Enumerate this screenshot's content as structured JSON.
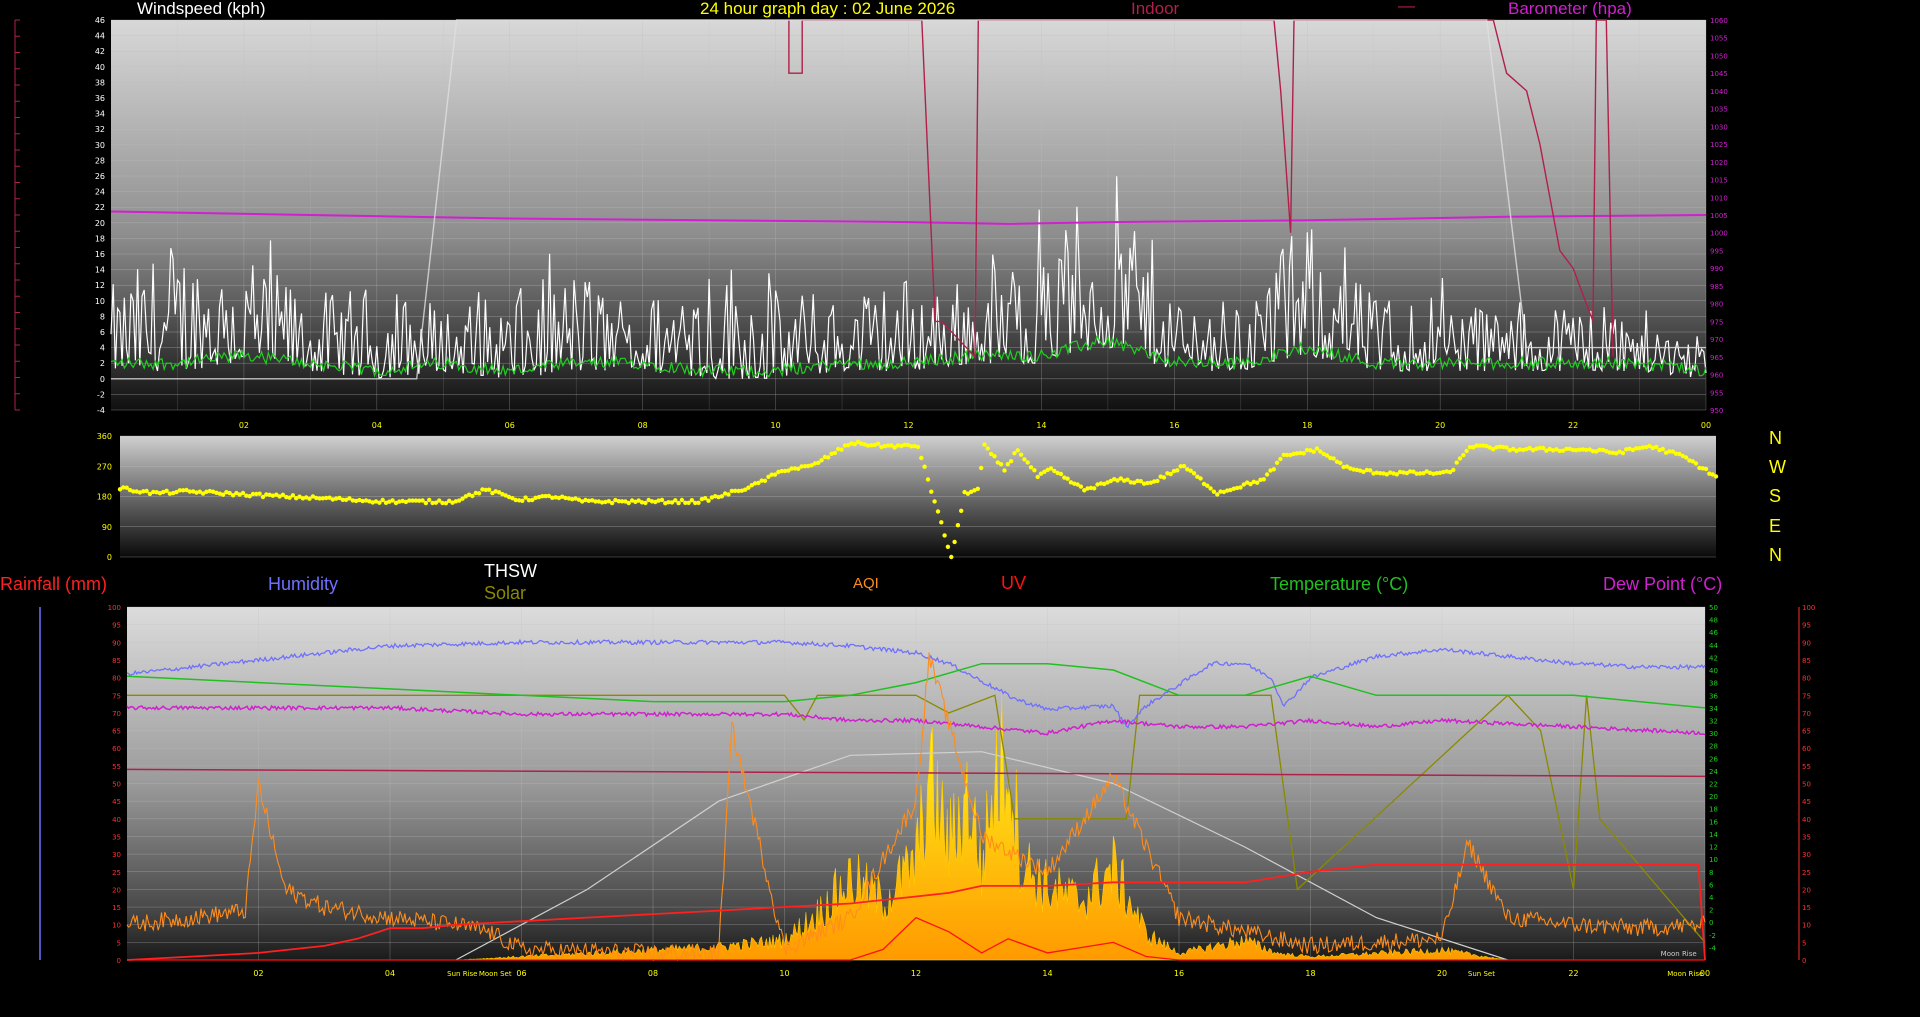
{
  "header": {
    "windspeed": "Windspeed (kph)",
    "title": "24 hour graph day : 02 June 2026",
    "indoor": "Indoor",
    "indoor_dash": "—",
    "barometer": "Barometer (hpa)"
  },
  "compass": [
    "N",
    "W",
    "S",
    "E",
    "N"
  ],
  "legend": {
    "rainfall": "Rainfall (mm)",
    "humidity": "Humidity",
    "thsw": "THSW",
    "solar": "Solar",
    "aqi": "AQI",
    "uv": "UV",
    "temperature": "Temperature (°C)",
    "dewpoint": "Dew Point (°C)"
  },
  "colors": {
    "windspeed": "#ffffff",
    "title": "#ffff00",
    "indoor": "#b0204a",
    "barometer": "#d020d0",
    "wind_dir": "#ffff00",
    "rainfall": "#ff2020",
    "humidity": "#7070ff",
    "solar": "#8a8a00",
    "aqi": "#ff8c1a",
    "uv": "#ff1010",
    "temperature": "#20c020",
    "dewpoint": "#d020d0"
  },
  "chart_data": [
    {
      "type": "line",
      "name": "wind-baro-panel",
      "title": "24 hour graph day : 02 June 2026",
      "x_ticks": [
        "02",
        "04",
        "06",
        "08",
        "10",
        "12",
        "14",
        "16",
        "18",
        "20",
        "22",
        "00"
      ],
      "xlim": [
        0,
        24
      ],
      "left_axis": {
        "label": "Windspeed (kph)",
        "ylim": [
          -4,
          46
        ],
        "ticks": [
          -4,
          -2,
          0,
          2,
          4,
          6,
          8,
          10,
          12,
          14,
          16,
          18,
          20,
          22,
          24,
          26,
          28,
          30,
          32,
          34,
          36,
          38,
          40,
          42,
          44,
          46
        ]
      },
      "right_axis": {
        "label": "Barometer (hpa)",
        "ylim": [
          950,
          1060
        ],
        "ticks": [
          950,
          955,
          960,
          965,
          970,
          975,
          980,
          985,
          990,
          995,
          1000,
          1005,
          1010,
          1015,
          1020,
          1025,
          1030,
          1035,
          1040,
          1045,
          1050,
          1055,
          1060
        ]
      },
      "series": [
        {
          "name": "Barometer (hpa)",
          "x": [
            0,
            3,
            6,
            9,
            12,
            13.5,
            15,
            18,
            21,
            24
          ],
          "y": [
            1006,
            1005,
            1004,
            1003.5,
            1003,
            1002.5,
            1003,
            1003.5,
            1004.5,
            1005
          ]
        },
        {
          "name": "Indoor",
          "x": [
            10.2,
            10.2,
            10.4,
            10.4,
            12.2,
            12.4,
            12.5,
            13.0,
            13.05,
            15.2,
            15.25,
            17.5,
            17.6,
            17.75,
            17.8,
            20.8,
            21.0,
            21.3,
            21.5,
            21.8,
            22.0,
            22.3,
            22.35,
            22.5,
            22.6
          ],
          "y": [
            1060,
            1045,
            1045,
            1060,
            1060,
            975,
            975,
            965,
            1060,
            1060,
            1060,
            1060,
            1040,
            1000,
            1060,
            1060,
            1045,
            1040,
            1025,
            995,
            990,
            975,
            1060,
            1060,
            965
          ]
        },
        {
          "name": "THSW",
          "x": [
            0,
            4.6,
            5.2,
            5.3,
            20.7,
            21.3,
            24
          ],
          "y": [
            0,
            0,
            46,
            46,
            46,
            4,
            4
          ]
        }
      ],
      "wind_profile": {
        "x": [
          0,
          1,
          2,
          3,
          4,
          5,
          6,
          7,
          8,
          9,
          10,
          11,
          12,
          13,
          14,
          15,
          16,
          17,
          18,
          19,
          20,
          21,
          22,
          23,
          24
        ],
        "gust_peak": [
          11,
          18,
          14,
          10,
          12,
          9,
          11,
          14,
          9,
          18,
          12,
          10,
          13,
          11,
          16,
          24,
          12,
          9,
          18,
          10,
          11,
          9,
          10,
          8,
          7
        ],
        "average": [
          2,
          2,
          3,
          2,
          1,
          2,
          1,
          2,
          2,
          1,
          1,
          2,
          2,
          3,
          3,
          5,
          2,
          2,
          4,
          2,
          2,
          2,
          2,
          2,
          1
        ]
      }
    },
    {
      "type": "scatter",
      "name": "wind-direction-panel",
      "xlim": [
        0,
        24
      ],
      "ylim": [
        0,
        360
      ],
      "y_ticks": [
        0,
        90,
        180,
        270,
        360
      ],
      "series": [
        {
          "name": "direction",
          "x": [
            0,
            0.5,
            1,
            2,
            3,
            4,
            5,
            5.5,
            6,
            6.5,
            7,
            8,
            8.7,
            9,
            9.5,
            10,
            10.4,
            11,
            11.5,
            12,
            12.5,
            12.6,
            12.7,
            12.9,
            13,
            13.3,
            13.5,
            13.8,
            14,
            14.5,
            15,
            15.5,
            16,
            16.5,
            17,
            17.2,
            17.5,
            18,
            18.5,
            19,
            20,
            20.3,
            21,
            22,
            22.5,
            23,
            23.5,
            24
          ],
          "y": [
            205,
            190,
            195,
            185,
            175,
            165,
            165,
            200,
            170,
            180,
            165,
            165,
            165,
            180,
            210,
            260,
            270,
            340,
            330,
            330,
            0,
            90,
            190,
            200,
            330,
            260,
            320,
            240,
            260,
            200,
            230,
            220,
            270,
            190,
            220,
            230,
            300,
            320,
            260,
            250,
            250,
            330,
            320,
            320,
            310,
            330,
            300,
            240
          ]
        }
      ]
    },
    {
      "type": "area",
      "name": "env-panel",
      "x_ticks": [
        "02",
        "04",
        "06",
        "08",
        "10",
        "12",
        "14",
        "16",
        "18",
        "20",
        "22",
        "00"
      ],
      "annotations": [
        "Sun Rise",
        "Moon Set",
        "Sun Set",
        "Moon Rise"
      ],
      "annotation_x": [
        5.1,
        5.6,
        20.6,
        23.7
      ],
      "xlim": [
        0,
        24
      ],
      "left_axis": {
        "ylim": [
          0,
          100
        ],
        "ticks": [
          0,
          5,
          10,
          15,
          20,
          25,
          30,
          35,
          40,
          45,
          50,
          55,
          60,
          65,
          70,
          75,
          80,
          85,
          90,
          95,
          100
        ]
      },
      "right_green_axis": {
        "ylim": [
          -6,
          50
        ],
        "ticks": [
          -4,
          -2,
          0,
          2,
          4,
          6,
          8,
          10,
          12,
          14,
          16,
          18,
          20,
          22,
          24,
          26,
          28,
          30,
          32,
          34,
          36,
          38,
          40,
          42,
          44,
          46,
          48,
          50
        ]
      },
      "right_red_axis": {
        "ylim": [
          0,
          100
        ],
        "ticks": [
          0,
          5,
          10,
          15,
          20,
          25,
          30,
          35,
          40,
          45,
          50,
          55,
          60,
          65,
          70,
          75,
          80,
          85,
          90,
          95,
          100
        ]
      },
      "series": [
        {
          "name": "Humidity",
          "x": [
            0,
            1,
            2,
            3,
            4,
            6,
            8,
            10,
            11,
            12,
            12.5,
            13,
            13.5,
            14,
            15,
            15.2,
            15.5,
            16,
            16.5,
            17,
            17.4,
            17.6,
            18,
            19,
            20,
            21,
            22,
            23,
            24
          ],
          "y": [
            81,
            83,
            85,
            87,
            89,
            90,
            90,
            90,
            89,
            87,
            84,
            79,
            74,
            71,
            72,
            66,
            72,
            78,
            84,
            84,
            80,
            72,
            80,
            86,
            88,
            86,
            84,
            83,
            83
          ]
        },
        {
          "name": "Temperature (°C)",
          "x": [
            0,
            2,
            4,
            6,
            8,
            10,
            11,
            12,
            13,
            14,
            15,
            16,
            17,
            18,
            19,
            20,
            22,
            24
          ],
          "y": [
            39,
            38,
            37,
            36,
            35,
            35,
            36,
            38,
            41,
            41,
            40,
            36,
            36,
            39,
            36,
            36,
            36,
            34
          ]
        },
        {
          "name": "Dew Point (°C)",
          "x": [
            0,
            2,
            4,
            6,
            8,
            10,
            11,
            12,
            13,
            14,
            15,
            16,
            17,
            18,
            19,
            20,
            22,
            24
          ],
          "y": [
            34,
            34,
            34,
            33,
            33,
            33,
            32,
            32,
            31,
            30,
            32,
            31,
            31,
            32,
            31,
            32,
            31,
            30
          ]
        },
        {
          "name": "Barometer",
          "x": [
            0,
            12,
            24
          ],
          "y": [
            54,
            53,
            52
          ]
        },
        {
          "name": "Rainfall (mm)",
          "x": [
            0,
            1,
            2,
            3,
            3.5,
            4,
            4.5,
            5,
            6,
            7,
            8,
            9,
            10,
            11,
            12,
            12.5,
            13,
            14,
            15,
            16,
            17,
            18,
            19,
            20,
            21,
            22,
            23,
            23.9,
            24
          ],
          "y": [
            0,
            1,
            2,
            4,
            6,
            9,
            9,
            10,
            11,
            12,
            13,
            14,
            15,
            16,
            18,
            19,
            21,
            21,
            22,
            22,
            22,
            25,
            27,
            27,
            27,
            27,
            27,
            27,
            0
          ]
        },
        {
          "name": "Solar",
          "x": [
            0,
            5,
            6,
            8,
            9,
            10,
            10.5,
            11,
            11.5,
            12,
            12.2,
            12.5,
            12.8,
            13,
            13.2,
            13.4,
            13.6,
            14,
            14.5,
            15,
            15.5,
            16,
            17,
            17.5,
            18,
            19,
            20,
            21,
            22,
            24
          ],
          "y": [
            0,
            0,
            1,
            3,
            4,
            6,
            14,
            25,
            18,
            30,
            55,
            35,
            50,
            28,
            55,
            65,
            30,
            22,
            18,
            28,
            8,
            2,
            6,
            2,
            1,
            2,
            3,
            0,
            0,
            0
          ]
        },
        {
          "name": "AQI",
          "x": [
            0,
            1,
            1.8,
            2,
            2.4,
            3,
            4,
            5,
            5.5,
            6,
            8,
            9,
            9.2,
            10,
            11,
            12,
            12.2,
            13,
            14,
            15,
            16,
            17,
            17.5,
            18,
            19,
            20,
            20.4,
            21,
            22,
            23,
            24
          ],
          "y": [
            10,
            12,
            14,
            50,
            20,
            15,
            12,
            10,
            8,
            3,
            2,
            2,
            66,
            3,
            12,
            45,
            86,
            35,
            25,
            52,
            12,
            8,
            6,
            4,
            5,
            6,
            33,
            12,
            10,
            9,
            10
          ]
        },
        {
          "name": "UV",
          "x": [
            0,
            11,
            11.5,
            12,
            12.5,
            13,
            13.4,
            14,
            15,
            15.5,
            16,
            24
          ],
          "y": [
            0,
            0,
            3,
            12,
            8,
            2,
            6,
            2,
            5,
            1,
            0,
            0
          ]
        },
        {
          "name": "THSW",
          "x": [
            0,
            10,
            10.3,
            10.5,
            12,
            12.5,
            13.2,
            13.5,
            15.2,
            15.4,
            17.4,
            17.8,
            21,
            21.5,
            22,
            22.2,
            22.4,
            24
          ],
          "y": [
            75,
            75,
            68,
            75,
            75,
            70,
            75,
            40,
            40,
            75,
            75,
            20,
            75,
            65,
            20,
            75,
            40,
            5
          ]
        },
        {
          "name": "Sun",
          "x": [
            5,
            7,
            9,
            11,
            13,
            15,
            17,
            19,
            21
          ],
          "y": [
            0,
            20,
            45,
            58,
            59,
            50,
            32,
            12,
            0
          ]
        }
      ]
    }
  ]
}
